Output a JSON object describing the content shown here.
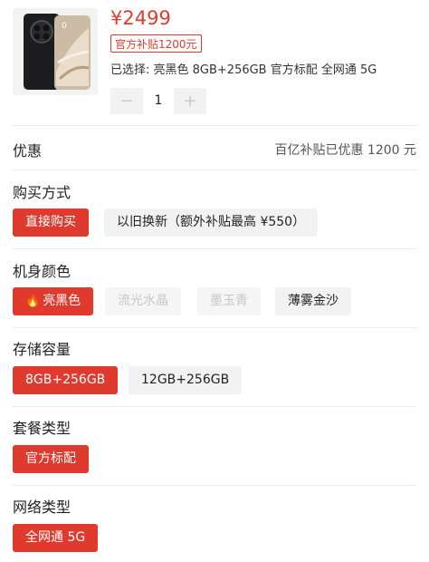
{
  "product": {
    "price": "¥2499",
    "subsidy_badge": "官方补贴1200元",
    "selected": "已选择: 亮黑色 8GB+256GB 官方标配 全网通 5G",
    "quantity": "1",
    "minus_icon": "−",
    "plus_icon": "+"
  },
  "discount": {
    "title": "优惠",
    "value": "百亿补贴已优惠 1200 元"
  },
  "purchase": {
    "title": "购买方式",
    "options": [
      "直接购买",
      "以旧换新（额外补贴最高 ¥550）"
    ]
  },
  "color": {
    "title": "机身颜色",
    "options": [
      "亮黑色",
      "流光水晶",
      "墨玉青",
      "薄雾金沙"
    ]
  },
  "storage": {
    "title": "存储容量",
    "options": [
      "8GB+256GB",
      "12GB+256GB"
    ]
  },
  "package": {
    "title": "套餐类型",
    "options": [
      "官方标配"
    ]
  },
  "network": {
    "title": "网络类型",
    "options": [
      "全网通 5G"
    ]
  },
  "colors": {
    "accent": "#e03a2e",
    "option_bg": "#f2f2f2",
    "disabled_text": "#c7c7c7"
  }
}
